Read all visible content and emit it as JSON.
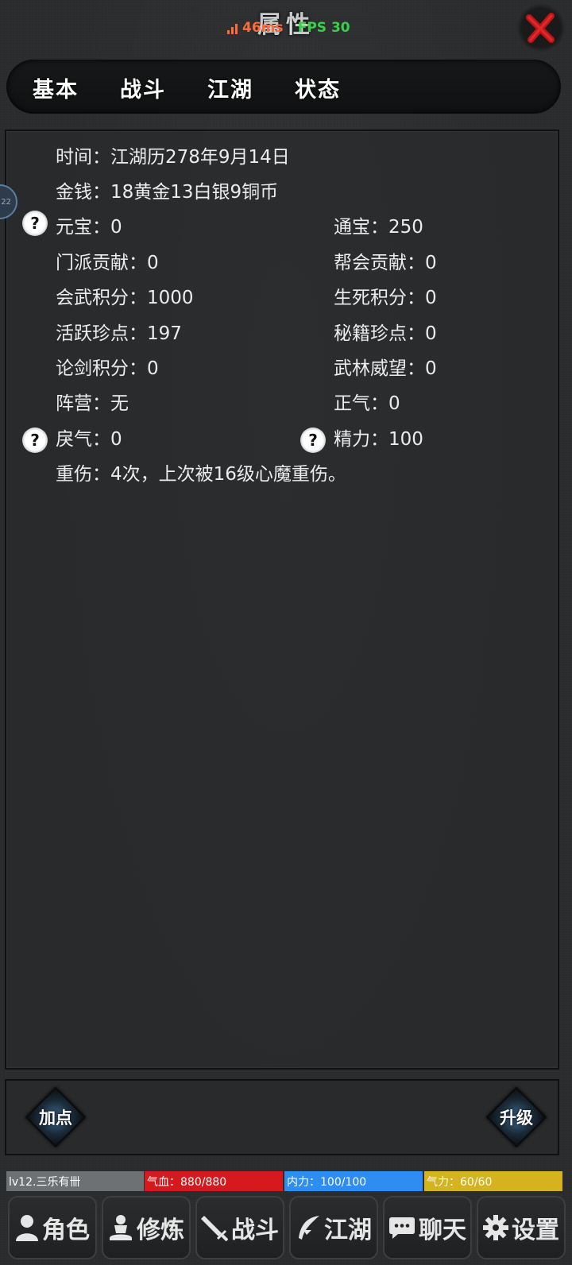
{
  "header": {
    "title": "属性",
    "ping": "46ms",
    "separator": "|",
    "fps": "FPS 30"
  },
  "tabs": [
    {
      "label": "基本",
      "active": false
    },
    {
      "label": "战斗",
      "active": false
    },
    {
      "label": "江湖",
      "active": true
    },
    {
      "label": "状态",
      "active": false
    }
  ],
  "side_tab": {
    "label": "22"
  },
  "stats": {
    "time": "时间：江湖历278年9月14日",
    "money": "金钱：18黄金13白银9铜币",
    "yuanbao": "元宝：0",
    "tongbao": "通宝：250",
    "sect_contrib": "门派贡献：0",
    "guild_contrib": "帮会贡献：0",
    "huiwu_score": "会武积分：1000",
    "shengsi_score": "生死积分：0",
    "active_points": "活跃珍点：197",
    "secret_points": "秘籍珍点：0",
    "lunjian_score": "论剑积分：0",
    "wulin_prestige": "武林威望：0",
    "faction": "阵营：无",
    "righteous": "正气：0",
    "hostility": "戾气：0",
    "energy": "精力：100",
    "injury": "重伤：4次，上次被16级心魔重伤。"
  },
  "actions": {
    "add_points": "加点",
    "upgrade": "升级"
  },
  "status_bars": {
    "level": "lv12.三乐有卌",
    "hp": "气血：880/880",
    "mp": "内力：100/100",
    "stamina": "气力：60/60",
    "colors": {
      "level": "#6e7174",
      "hp": "#d6191c",
      "mp": "#2f8cf0",
      "stamina": "#d6b21e"
    }
  },
  "nav": [
    {
      "label": "角色",
      "icon": "person-icon"
    },
    {
      "label": "修炼",
      "icon": "meditate-icon"
    },
    {
      "label": "战斗",
      "icon": "sword-icon"
    },
    {
      "label": "江湖",
      "icon": "feather-icon"
    },
    {
      "label": "聊天",
      "icon": "chat-icon"
    },
    {
      "label": "设置",
      "icon": "gear-icon"
    }
  ]
}
